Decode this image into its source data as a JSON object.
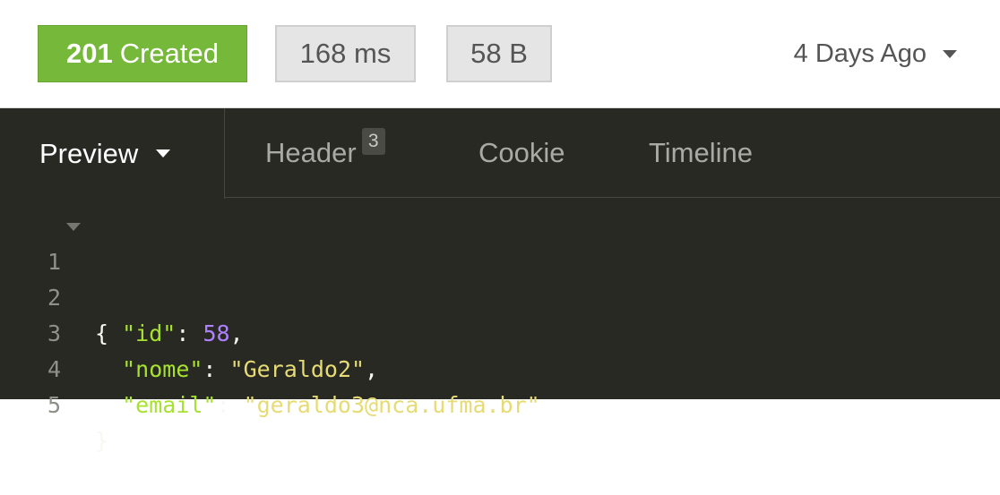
{
  "response": {
    "status_code": "201",
    "status_text": "Created",
    "time": "168 ms",
    "size": "58 B",
    "history_label": "4 Days Ago"
  },
  "tabs": {
    "preview": "Preview",
    "header": "Header",
    "header_count": "3",
    "cookie": "Cookie",
    "timeline": "Timeline"
  },
  "code": {
    "line_numbers": [
      "1",
      "2",
      "3",
      "4",
      "5"
    ],
    "open_brace": "{",
    "close_brace": "}",
    "key_id": "\"id\"",
    "value_id": "58",
    "key_nome": "\"nome\"",
    "value_nome": "\"Geraldo2\"",
    "key_email": "\"email\"",
    "value_email": "\"geraldo3@nca.ufma.br\"",
    "colon": ": ",
    "comma": ","
  },
  "colors": {
    "status_success": "#75b83a",
    "panel_bg": "#282923",
    "json_key": "#a6e22e",
    "json_string": "#e6db74",
    "json_number": "#ae81ff"
  },
  "icons": {
    "history_dropdown": "chevron-down-icon",
    "preview_dropdown": "chevron-down-icon",
    "fold_toggle": "fold-arrow-icon"
  }
}
